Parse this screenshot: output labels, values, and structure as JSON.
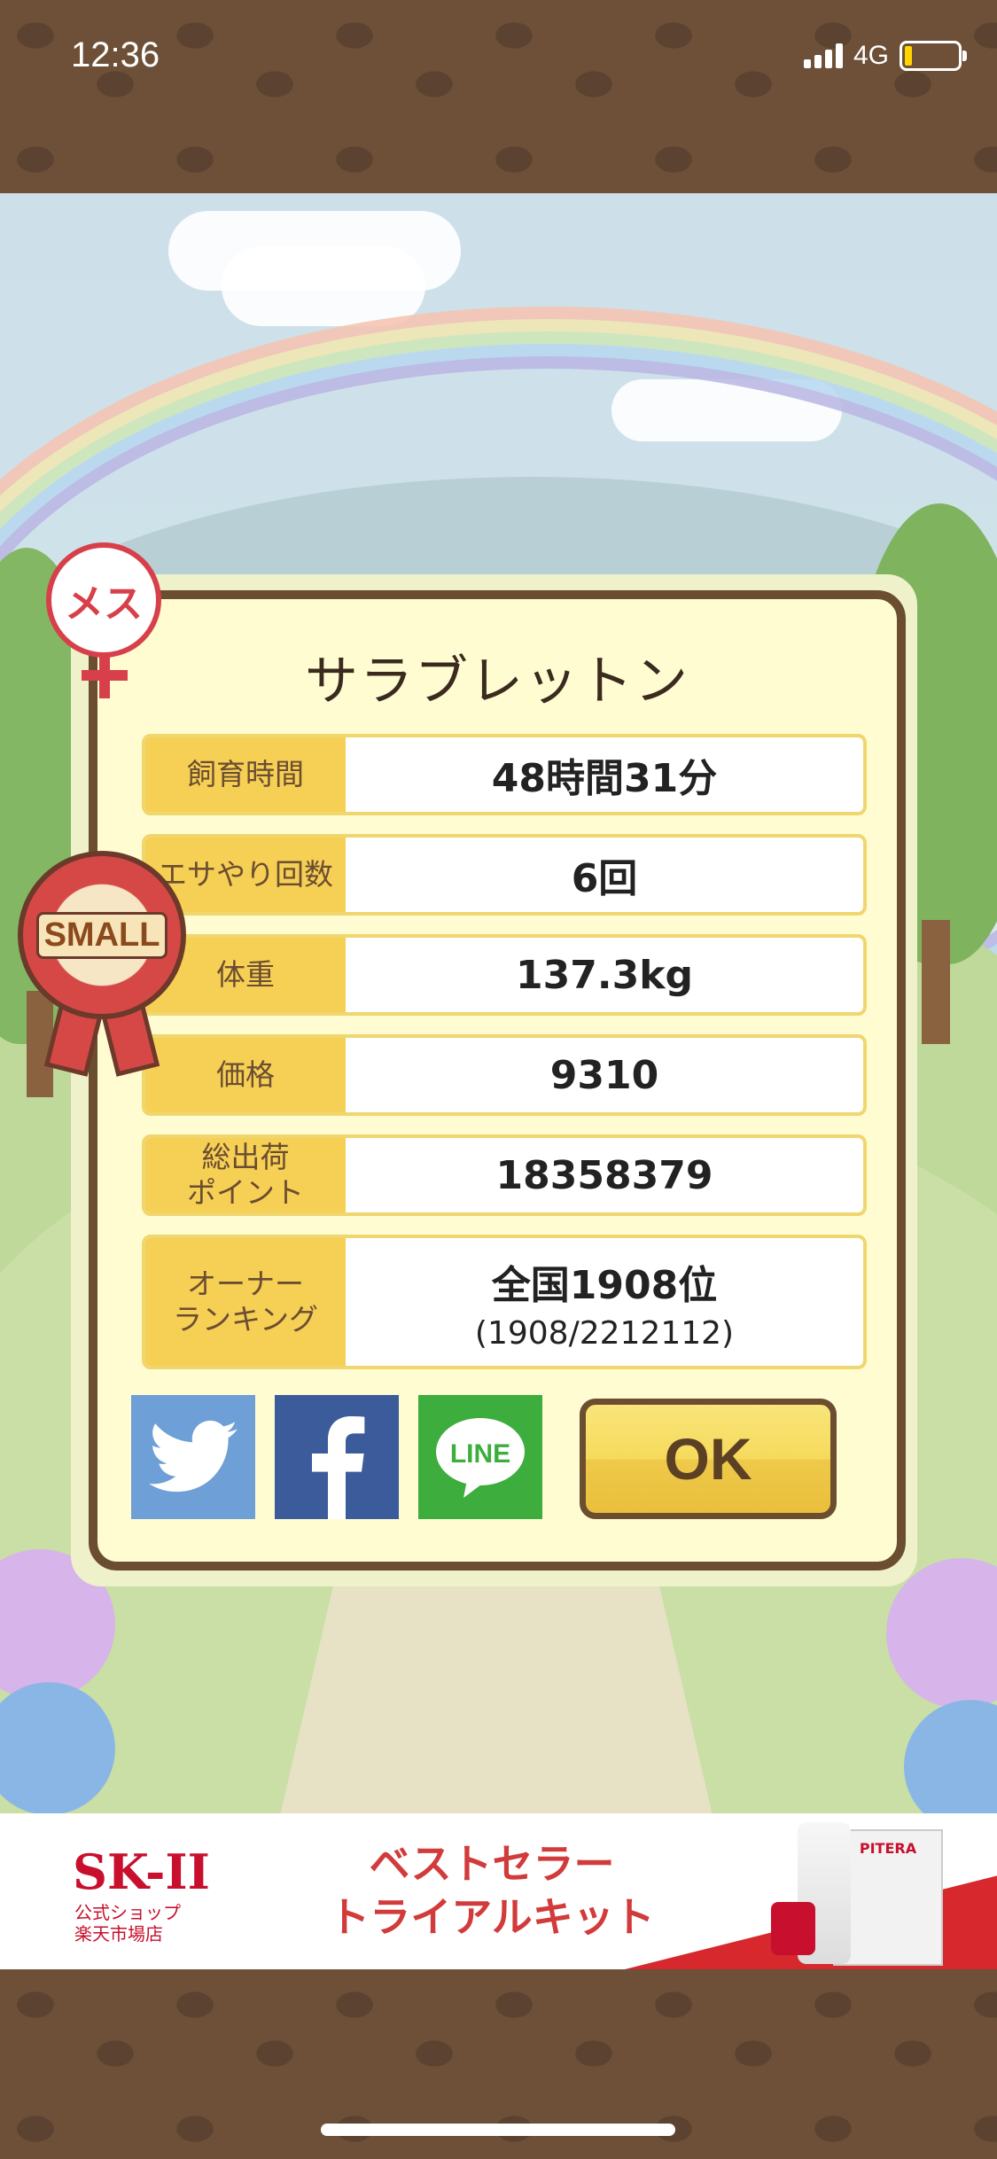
{
  "status_bar": {
    "time": "12:36",
    "network": "4G",
    "battery_level_fraction": 0.15
  },
  "gender_badge": {
    "text": "メス"
  },
  "size_badge": {
    "text": "SMALL"
  },
  "dialog": {
    "title": "サラブレットン",
    "rows": [
      {
        "label": "飼育時間",
        "value": "48時間31分"
      },
      {
        "label": "エサやり回数",
        "value": "6回"
      },
      {
        "label": "体重",
        "value": "137.3kg"
      },
      {
        "label": "価格",
        "value": "9310"
      },
      {
        "label": "総出荷\nポイント",
        "value": "18358379"
      },
      {
        "label": "オーナー\nランキング",
        "value": "全国1908位",
        "sub": "(1908/2212112)"
      }
    ],
    "share": [
      {
        "name": "twitter",
        "color": "#6e9fd6"
      },
      {
        "name": "facebook",
        "color": "#3b5b9a"
      },
      {
        "name": "line",
        "color": "#3dad3d",
        "label": "LINE"
      }
    ],
    "ok_label": "OK"
  },
  "ad": {
    "brand": "SK-II",
    "sub": "公式ショップ\n楽天市場店",
    "copy_line1": "ベストセラー",
    "copy_line2": "トライアルキット",
    "product_label": "PITERA"
  }
}
